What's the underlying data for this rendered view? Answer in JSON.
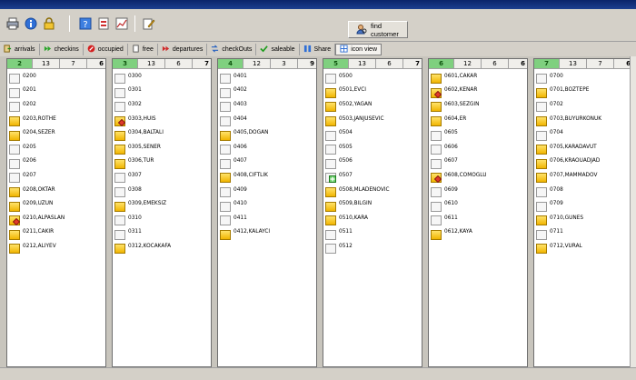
{
  "toolbar": {
    "find_customer_label": "find customer",
    "icons": [
      "printer-icon",
      "info-icon",
      "lock-icon",
      "help-icon",
      "report-icon",
      "chart-icon",
      "edit-icon",
      "search-user-icon"
    ]
  },
  "tabs": [
    {
      "label": "arrivals",
      "icon": "door-icon"
    },
    {
      "label": "checkins",
      "icon": "double-arrow-icon"
    },
    {
      "label": "occupied",
      "icon": "stop-icon"
    },
    {
      "label": "free",
      "icon": "page-icon"
    },
    {
      "label": "departures",
      "icon": "red-arrow-icon"
    },
    {
      "label": "checkOuts",
      "icon": "transfer-icon"
    },
    {
      "label": "saleable",
      "icon": "check-icon"
    },
    {
      "label": "Share",
      "icon": "share-icon"
    },
    {
      "label": "icon view",
      "icon": "grid-icon",
      "active": true
    }
  ],
  "colors": {
    "floor_header": "#7fd07f",
    "occupied": "#f1b500",
    "free": "#f6f6f6",
    "panel": "#d4d0c8"
  },
  "floors": [
    {
      "floor": "2",
      "total": "13",
      "free": "7",
      "occupied": "6",
      "rooms": [
        {
          "label": "0200",
          "occupied": false
        },
        {
          "label": "0201",
          "occupied": false
        },
        {
          "label": "0202",
          "occupied": false
        },
        {
          "label": "0203,ROTHE",
          "occupied": true
        },
        {
          "label": "0204,SEZER",
          "occupied": true
        },
        {
          "label": "0205",
          "occupied": false
        },
        {
          "label": "0206",
          "occupied": false
        },
        {
          "label": "0207",
          "occupied": false
        },
        {
          "label": "0208,OKTAR",
          "occupied": true
        },
        {
          "label": "0209,UZUN",
          "occupied": true
        },
        {
          "label": "0210,ALPASLAN",
          "occupied": true,
          "flag": "departure"
        },
        {
          "label": "0211,CAKIR",
          "occupied": true
        },
        {
          "label": "0212,ALIYEV",
          "occupied": true
        }
      ]
    },
    {
      "floor": "3",
      "total": "13",
      "free": "6",
      "occupied": "7",
      "rooms": [
        {
          "label": "0300",
          "occupied": false
        },
        {
          "label": "0301",
          "occupied": false
        },
        {
          "label": "0302",
          "occupied": false
        },
        {
          "label": "0303,HUIS",
          "occupied": true,
          "flag": "departure"
        },
        {
          "label": "0304,BALTALI",
          "occupied": true
        },
        {
          "label": "0305,SENER",
          "occupied": true
        },
        {
          "label": "0306,TUR",
          "occupied": true
        },
        {
          "label": "0307",
          "occupied": false
        },
        {
          "label": "0308",
          "occupied": false
        },
        {
          "label": "0309,EMEKSIZ",
          "occupied": true
        },
        {
          "label": "0310",
          "occupied": false
        },
        {
          "label": "0311",
          "occupied": false
        },
        {
          "label": "0312,KOCAKAFA",
          "occupied": true
        }
      ]
    },
    {
      "floor": "4",
      "total": "12",
      "free": "3",
      "occupied": "9",
      "rooms": [
        {
          "label": "0401",
          "occupied": false
        },
        {
          "label": "0402",
          "occupied": false
        },
        {
          "label": "0403",
          "occupied": false
        },
        {
          "label": "0404",
          "occupied": false
        },
        {
          "label": "0405,DOGAN",
          "occupied": true
        },
        {
          "label": "0406",
          "occupied": false
        },
        {
          "label": "0407",
          "occupied": false
        },
        {
          "label": "0408,CIFTLIK",
          "occupied": true
        },
        {
          "label": "0409",
          "occupied": false
        },
        {
          "label": "0410",
          "occupied": false
        },
        {
          "label": "0411",
          "occupied": false
        },
        {
          "label": "0412,KALAYCI",
          "occupied": true
        }
      ]
    },
    {
      "floor": "5",
      "total": "13",
      "free": "6",
      "occupied": "7",
      "rooms": [
        {
          "label": "0500",
          "occupied": false
        },
        {
          "label": "0501,EVCI",
          "occupied": true
        },
        {
          "label": "0502,YAGAN",
          "occupied": true
        },
        {
          "label": "0503,JANJUSEVIC",
          "occupied": true
        },
        {
          "label": "0504",
          "occupied": false
        },
        {
          "label": "0505",
          "occupied": false
        },
        {
          "label": "0506",
          "occupied": false
        },
        {
          "label": "0507",
          "occupied": false,
          "flag": "arrival"
        },
        {
          "label": "0508,MLADENOVIC",
          "occupied": true
        },
        {
          "label": "0509,BILGIN",
          "occupied": true
        },
        {
          "label": "0510,KARA",
          "occupied": true
        },
        {
          "label": "0511",
          "occupied": false
        },
        {
          "label": "0512",
          "occupied": false
        }
      ]
    },
    {
      "floor": "6",
      "total": "12",
      "free": "6",
      "occupied": "6",
      "rooms": [
        {
          "label": "0601,CAKAR",
          "occupied": true
        },
        {
          "label": "0602,KENAR",
          "occupied": true,
          "flag": "departure"
        },
        {
          "label": "0603,SEZGIN",
          "occupied": true
        },
        {
          "label": "0604,ER",
          "occupied": true
        },
        {
          "label": "0605",
          "occupied": false
        },
        {
          "label": "0606",
          "occupied": false
        },
        {
          "label": "0607",
          "occupied": false
        },
        {
          "label": "0608,COMOGLU",
          "occupied": true,
          "flag": "departure"
        },
        {
          "label": "0609",
          "occupied": false
        },
        {
          "label": "0610",
          "occupied": false
        },
        {
          "label": "0611",
          "occupied": false
        },
        {
          "label": "0612,KAYA",
          "occupied": true
        }
      ]
    },
    {
      "floor": "7",
      "total": "13",
      "free": "7",
      "occupied": "6",
      "rooms": [
        {
          "label": "0700",
          "occupied": false
        },
        {
          "label": "0701,BOZTEPE",
          "occupied": true
        },
        {
          "label": "0702",
          "occupied": false
        },
        {
          "label": "0703,BUYURKONUK",
          "occupied": true
        },
        {
          "label": "0704",
          "occupied": false
        },
        {
          "label": "0705,KARADAVUT",
          "occupied": true
        },
        {
          "label": "0706,KRAOUADJAD",
          "occupied": true
        },
        {
          "label": "0707,MAMMADOV",
          "occupied": true
        },
        {
          "label": "0708",
          "occupied": false
        },
        {
          "label": "0709",
          "occupied": false
        },
        {
          "label": "0710,GUNES",
          "occupied": true
        },
        {
          "label": "0711",
          "occupied": false
        },
        {
          "label": "0712,VURAL",
          "occupied": true
        }
      ]
    }
  ]
}
